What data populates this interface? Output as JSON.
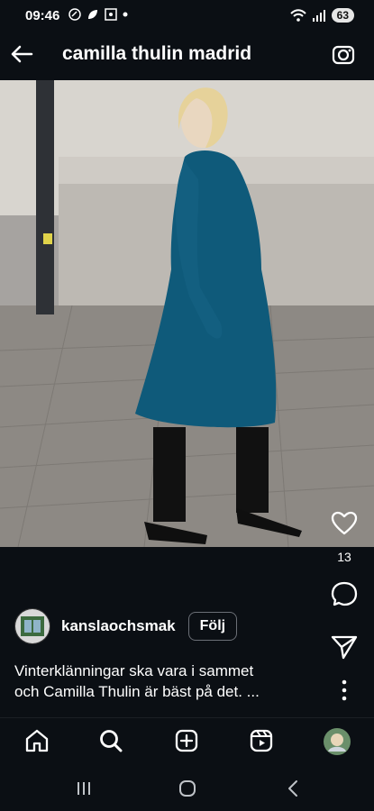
{
  "status": {
    "time": "09:46",
    "battery": "63"
  },
  "header": {
    "title": "camilla thulin madrid"
  },
  "post": {
    "like_count": "13",
    "author": "kanslaochsmak",
    "follow_label": "Följ",
    "caption_line1": "Vinterklänningar ska vara i sammet",
    "caption_line2": "och Camilla Thulin är bäst på det. ..."
  },
  "icons": {
    "back": "arrow-left-icon",
    "camera": "camera-icon",
    "like": "heart-icon",
    "comment": "comment-icon",
    "share": "send-icon",
    "more": "more-vertical-icon",
    "home": "home-icon",
    "search": "search-icon",
    "create": "plus-square-icon",
    "reels": "reels-icon",
    "profile": "profile-avatar"
  },
  "colors": {
    "background": "#0b0f14",
    "dress": "#0f5a7a"
  }
}
